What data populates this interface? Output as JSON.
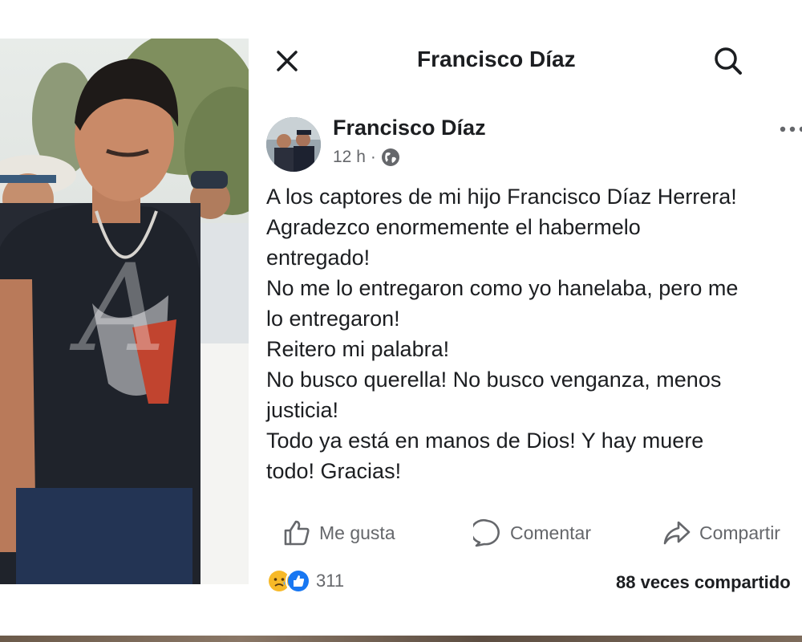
{
  "header": {
    "title": "Francisco Díaz",
    "close_icon": "close-icon",
    "search_icon": "search-icon"
  },
  "photo": {
    "description_icon": "photo",
    "watermark": "A"
  },
  "post": {
    "author": "Francisco Díaz",
    "time": "12 h",
    "separator": "·",
    "audience_icon": "globe-icon",
    "more_icon": "more-icon",
    "lines": [
      "A los captores de mi hijo Francisco Díaz Herrera!",
      "Agradezco enormemente el habermelo",
      "entregado!",
      "No me lo entregaron como yo hanelaba, pero me",
      "lo entregaron!",
      "Reitero mi palabra!",
      "No busco querella! No busco venganza, menos",
      "justicia!",
      "Todo ya está en manos de Dios! Y hay muere",
      "todo! Gracias!"
    ]
  },
  "actions": {
    "like": "Me gusta",
    "comment": "Comentar",
    "share": "Compartir"
  },
  "stats": {
    "reaction_count": "311",
    "shares": "88 veces compartido"
  },
  "colors": {
    "text": "#1c1e21",
    "muted": "#65676b",
    "like_blue": "#1877f2",
    "sad_yellow": "#f7b928"
  }
}
